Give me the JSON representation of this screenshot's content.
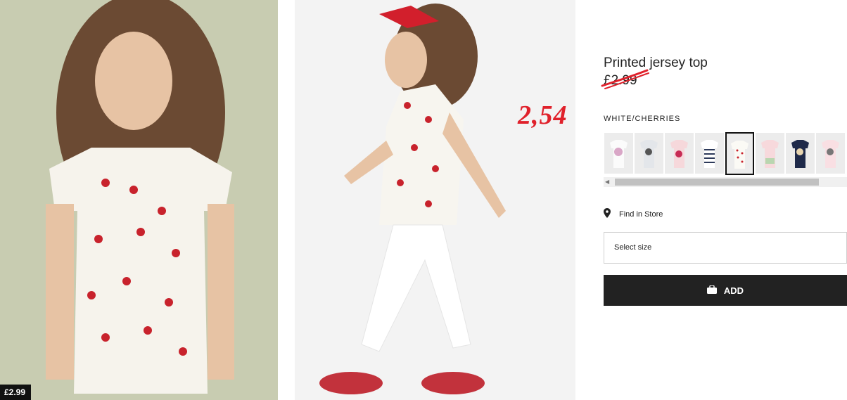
{
  "product": {
    "title": "Printed jersey top",
    "old_price": "£2.99",
    "promo_price": "2,54",
    "color_name": "WHITE/CHERRIES",
    "thumb_price": "£2.99"
  },
  "colors": {
    "promo": "#e0212b",
    "button_bg": "#222222"
  },
  "actions": {
    "find_in_store": "Find in Store",
    "select_size": "Select size",
    "add": "ADD"
  },
  "icons": {
    "find_in_store": "map-pin-icon",
    "add": "shopping-bag-icon"
  }
}
